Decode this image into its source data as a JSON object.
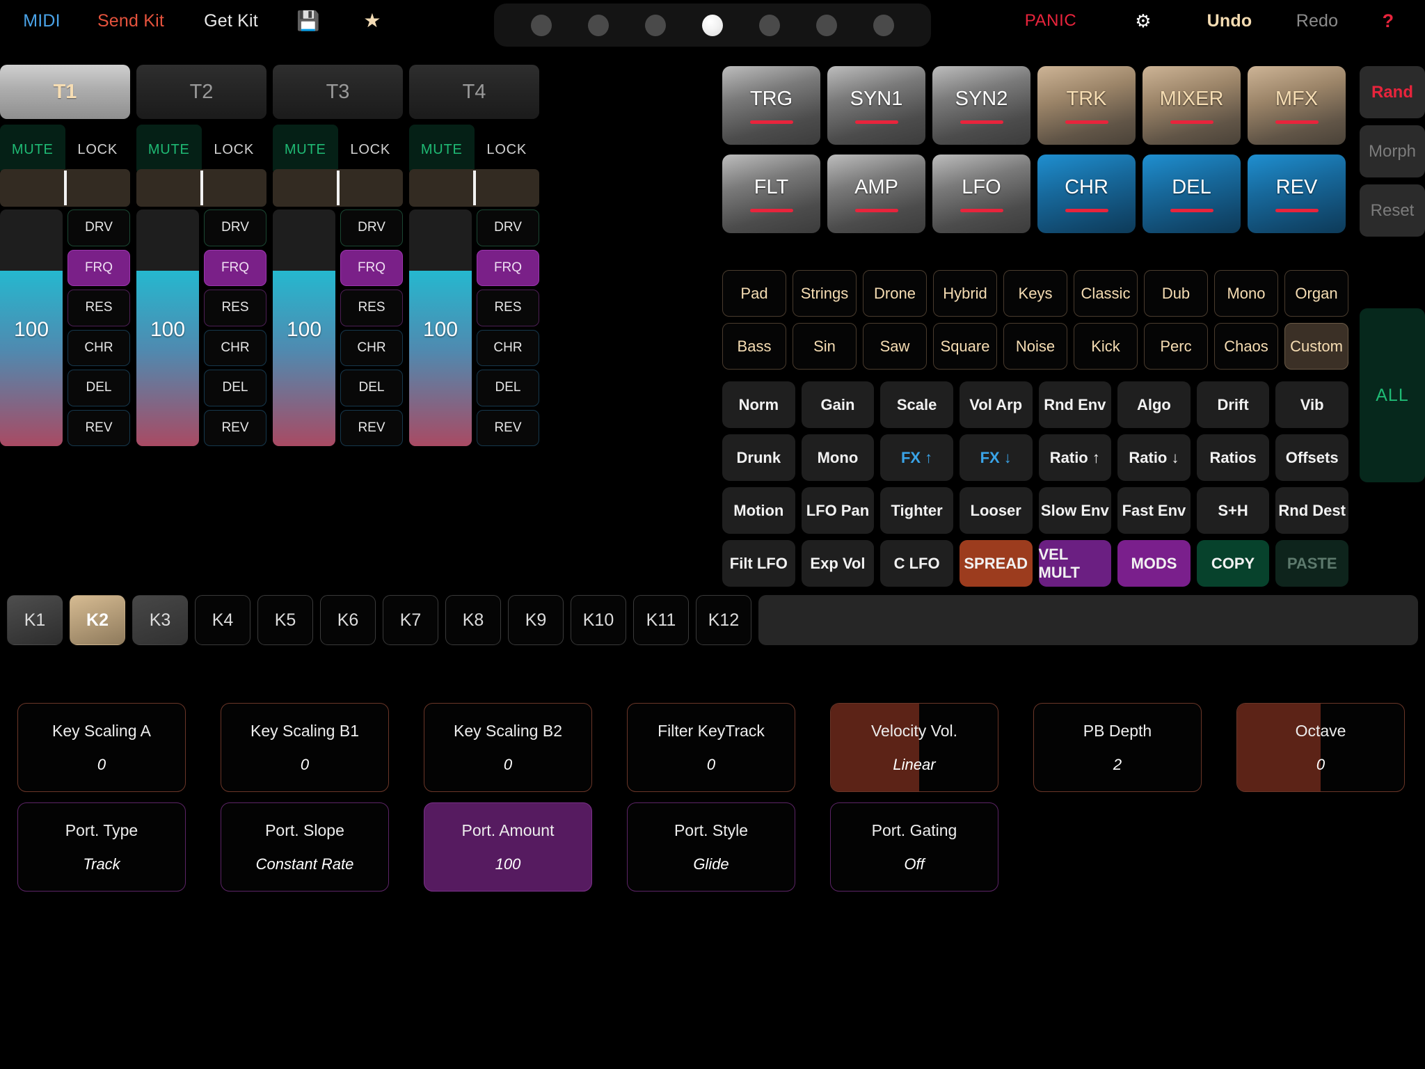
{
  "toolbar": {
    "midi": "MIDI",
    "send_kit": "Send Kit",
    "get_kit": "Get Kit",
    "save_icon": "floppy-disk-icon",
    "star_icon": "star-icon",
    "panic": "PANIC",
    "settings_icon": "gear-icon",
    "undo": "Undo",
    "redo": "Redo",
    "help": "?",
    "pattern_dots": {
      "count": 7,
      "active_index": 3
    }
  },
  "tracks": [
    {
      "label": "T1",
      "selected": true,
      "mute": "MUTE",
      "lock": "LOCK",
      "value": "100"
    },
    {
      "label": "T2",
      "selected": false,
      "mute": "MUTE",
      "lock": "LOCK",
      "value": "100"
    },
    {
      "label": "T3",
      "selected": false,
      "mute": "MUTE",
      "lock": "LOCK",
      "value": "100"
    },
    {
      "label": "T4",
      "selected": false,
      "mute": "MUTE",
      "lock": "LOCK",
      "value": "100"
    }
  ],
  "fx_labels": [
    "DRV",
    "FRQ",
    "RES",
    "CHR",
    "DEL",
    "REV"
  ],
  "fx_active": "FRQ",
  "modules": {
    "row1": [
      {
        "label": "TRG",
        "style": "grey"
      },
      {
        "label": "SYN1",
        "style": "grey"
      },
      {
        "label": "SYN2",
        "style": "grey"
      },
      {
        "label": "TRK",
        "style": "tan"
      },
      {
        "label": "MIXER",
        "style": "tan"
      },
      {
        "label": "MFX",
        "style": "tan"
      }
    ],
    "row2": [
      {
        "label": "FLT",
        "style": "grey"
      },
      {
        "label": "AMP",
        "style": "grey"
      },
      {
        "label": "LFO",
        "style": "grey"
      },
      {
        "label": "CHR",
        "style": "blue"
      },
      {
        "label": "DEL",
        "style": "blue"
      },
      {
        "label": "REV",
        "style": "blue"
      }
    ]
  },
  "side_buttons": {
    "rand": "Rand",
    "morph": "Morph",
    "reset": "Reset",
    "all": "ALL"
  },
  "categories": {
    "row1": [
      "Pad",
      "Strings",
      "Drone",
      "Hybrid",
      "Keys",
      "Classic",
      "Dub",
      "Mono",
      "Organ"
    ],
    "row2": [
      "Bass",
      "Sin",
      "Saw",
      "Square",
      "Noise",
      "Kick",
      "Perc",
      "Chaos",
      "Custom"
    ],
    "selected": "Custom"
  },
  "functions": {
    "row1": [
      "Norm",
      "Gain",
      "Scale",
      "Vol Arp",
      "Rnd Env",
      "Algo",
      "Drift",
      "Vib"
    ],
    "row2": [
      "Drunk",
      "Mono",
      "FX ↑",
      "FX ↓",
      "Ratio ↑",
      "Ratio ↓",
      "Ratios",
      "Offsets"
    ],
    "row3": [
      "Motion",
      "LFO Pan",
      "Tighter",
      "Looser",
      "Slow Env",
      "Fast Env",
      "S+H",
      "Rnd Dest"
    ],
    "row4": [
      "Filt LFO",
      "Exp Vol",
      "C LFO",
      "SPREAD",
      "VEL MULT",
      "MODS",
      "COPY",
      "PASTE"
    ]
  },
  "kit_slots": {
    "labels": [
      "K1",
      "K2",
      "K3",
      "K4",
      "K5",
      "K6",
      "K7",
      "K8",
      "K9",
      "K10",
      "K11",
      "K12"
    ],
    "selected": "K2"
  },
  "param_cards": {
    "row1": [
      {
        "title": "Key Scaling A",
        "value": "0",
        "style": "orange",
        "fill": 0
      },
      {
        "title": "Key Scaling B1",
        "value": "0",
        "style": "orange",
        "fill": 0
      },
      {
        "title": "Key Scaling B2",
        "value": "0",
        "style": "orange",
        "fill": 0
      },
      {
        "title": "Filter KeyTrack",
        "value": "0",
        "style": "orange",
        "fill": 0
      },
      {
        "title": "Velocity Vol.",
        "value": "Linear",
        "style": "orange",
        "fill": 53
      },
      {
        "title": "PB Depth",
        "value": "2",
        "style": "orange",
        "fill": 0
      },
      {
        "title": "Octave",
        "value": "0",
        "style": "orange",
        "fill": 50
      }
    ],
    "row2": [
      {
        "title": "Port. Type",
        "value": "Track",
        "style": "purple",
        "fill": 0
      },
      {
        "title": "Port. Slope",
        "value": "Constant Rate",
        "style": "purple",
        "fill": 0
      },
      {
        "title": "Port. Amount",
        "value": "100",
        "style": "purple-fill",
        "fill": 0
      },
      {
        "title": "Port. Style",
        "value": "Glide",
        "style": "purple",
        "fill": 0
      },
      {
        "title": "Port. Gating",
        "value": "Off",
        "style": "purple",
        "fill": 0
      }
    ]
  },
  "colors": {
    "accent_red": "#e8243c",
    "accent_tan": "#f6ddb3",
    "accent_blue": "#3aa4e8",
    "accent_green": "#1fba74",
    "accent_purple": "#7a2088"
  }
}
